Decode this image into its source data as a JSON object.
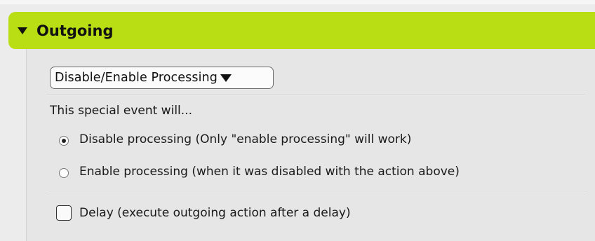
{
  "section": {
    "title": "Outgoing",
    "collapse_icon": "triangle-down-icon"
  },
  "dropdown": {
    "selected": "Disable/Enable Processing",
    "icon": "triangle-down-icon"
  },
  "intro_text": "This special event will...",
  "options": [
    {
      "label": "Disable processing (Only \"enable processing\" will work)",
      "selected": true
    },
    {
      "label": "Enable processing (when it was disabled with the action above)",
      "selected": false
    }
  ],
  "delay": {
    "label": "Delay (execute outgoing action after a delay)",
    "checked": false
  },
  "colors": {
    "header": "#b9df14",
    "panel": "#e6e6e6"
  }
}
